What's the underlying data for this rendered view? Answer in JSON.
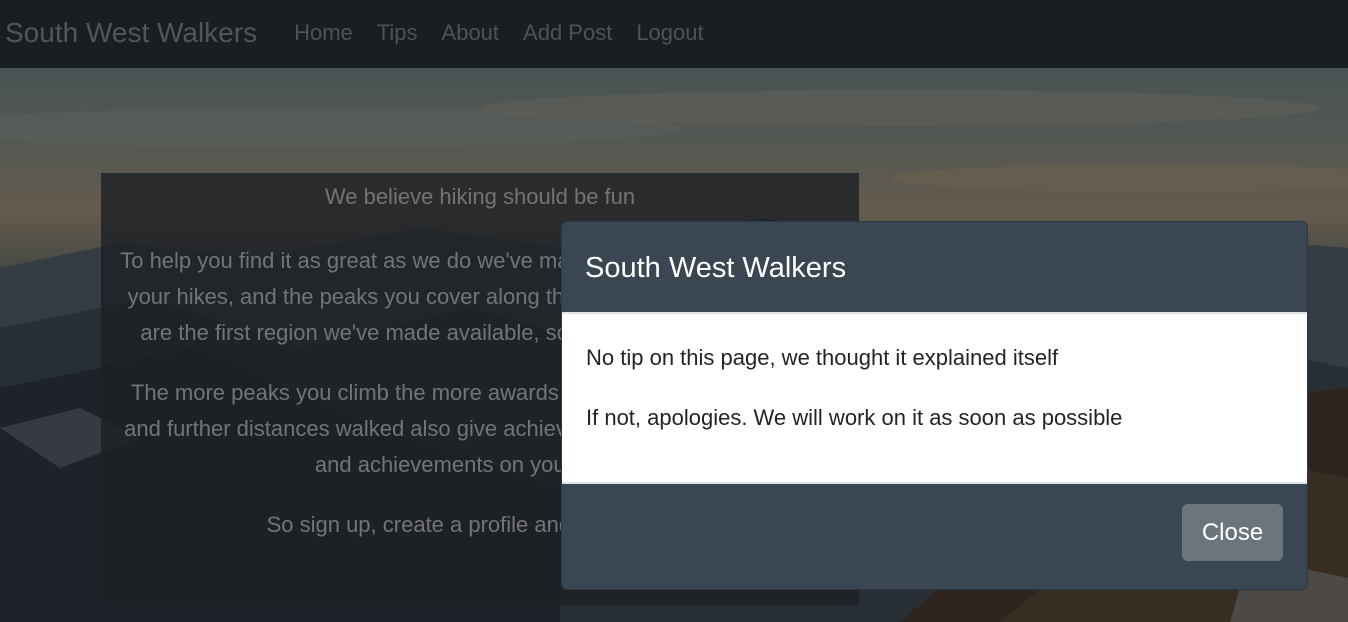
{
  "nav": {
    "brand": "South West Walkers",
    "links": [
      "Home",
      "Tips",
      "About",
      "Add Post",
      "Logout"
    ]
  },
  "info": {
    "headline": "We believe hiking should be fun",
    "para1": "To help you find it as great as we do we've made a system for you to track your hikes, and the peaks you cover along the way. The brecon beacons are the first region we've made available, so keep an eye out for more",
    "para2": "The more peaks you climb the more awards you will earn. Higher peaks and further distances walked also give achievements. Share your awards and achievements on your profile.",
    "para3": "So sign up, create a profile and get walking!"
  },
  "modal": {
    "title": "South West Walkers",
    "line1": "No tip on this page, we thought it explained itself",
    "line2": "If not, apologies. We will work on it as soon as possible",
    "close_label": "Close"
  },
  "colors": {
    "navbar": "#353c44",
    "modal_header": "#3a4753",
    "close_button": "#6c757d"
  }
}
